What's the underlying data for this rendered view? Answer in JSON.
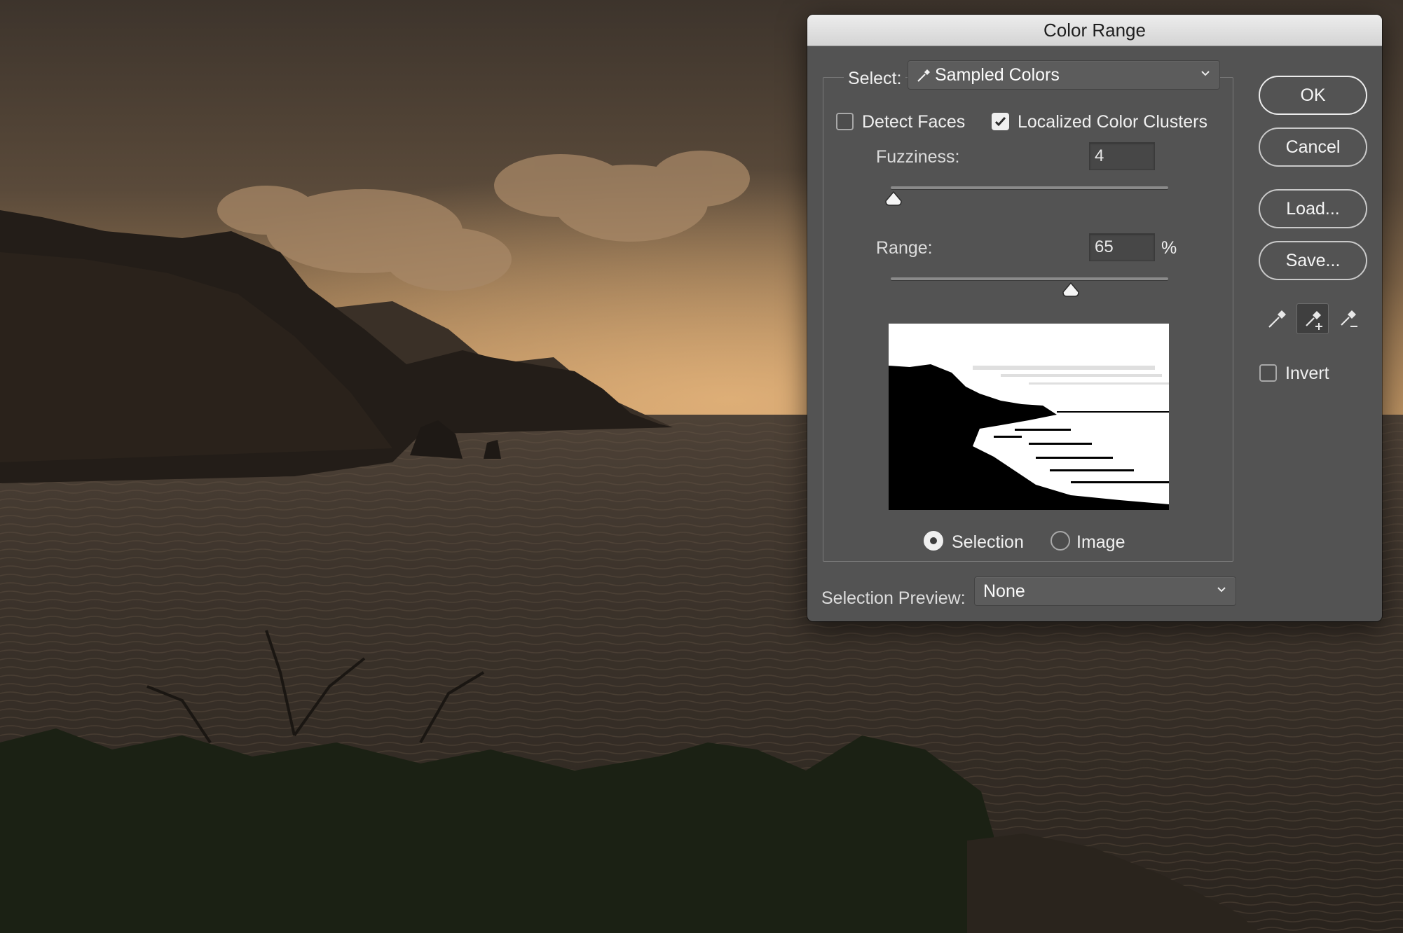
{
  "dialog": {
    "title": "Color Range",
    "select_label": "Select:",
    "select_value": "Sampled Colors",
    "detect_faces_label": "Detect Faces",
    "detect_faces_checked": false,
    "localized_clusters_label": "Localized Color Clusters",
    "localized_clusters_checked": true,
    "fuzziness_label": "Fuzziness:",
    "fuzziness_value": "4",
    "fuzziness_slider_fraction": 0.01,
    "range_label": "Range:",
    "range_value": "65",
    "range_unit": "%",
    "range_slider_fraction": 0.65,
    "view_selection_label": "Selection",
    "view_image_label": "Image",
    "view_selected": "selection",
    "selection_preview_label": "Selection Preview:",
    "selection_preview_value": "None",
    "invert_label": "Invert",
    "invert_checked": false
  },
  "buttons": {
    "ok": "OK",
    "cancel": "Cancel",
    "load": "Load...",
    "save": "Save..."
  },
  "eyedroppers": [
    {
      "name": "eyedropper-icon",
      "active": false
    },
    {
      "name": "add-to-sample-icon",
      "active": true
    },
    {
      "name": "subtract-from-sample-icon",
      "active": false
    }
  ],
  "colors": {
    "dialog_bg": "#535353",
    "titlebar": "#dedede",
    "photo_sky_glow": "#c79a63",
    "photo_dark": "#231d18"
  }
}
